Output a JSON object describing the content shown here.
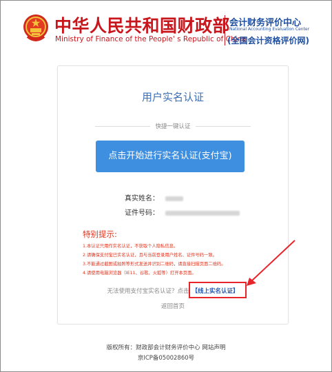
{
  "header": {
    "ministry_cn": "中华人民共和国财政部",
    "ministry_en": "Ministry of Finance of the People' s Republic of China",
    "center_cn": "会计财务评价中心",
    "center_en": "National Accounting Evaluation Center",
    "center_sub": "(全国会计资格评价网)"
  },
  "card": {
    "title": "用户实名认证",
    "quick_label": "快捷一键认证",
    "alipay_button": "点击开始进行实名认证(支付宝)",
    "name_label": "真实姓名：",
    "id_label": "证件号码："
  },
  "notice": {
    "title": "特别提示:",
    "items": [
      "1.本认证只用作实名认证，不获取个人隐私信息。",
      "2.请确保支付宝已实名认证，且与当前登录用户姓名、证件号码一致。",
      "3.不能通过截图或拍照等形式发送并识别二维码，请直接扫描页面二维码。",
      "4.请使用电脑浏览器（IE11、谷歌、火狐等）打开本页面。"
    ]
  },
  "alt": {
    "question": "无法使用支付宝实名认证？点击",
    "offline_link": "【线上实名认证】"
  },
  "back_link": "返回首页",
  "footer": {
    "line1": "版权所有：财政部会计财务评价中心   网站声明",
    "line2": "京ICP备05002860号"
  },
  "colors": {
    "brand_red": "#c8161d",
    "brand_blue": "#1f4fa0",
    "button_blue": "#3e8fe0",
    "notice_red": "#e0331c"
  }
}
